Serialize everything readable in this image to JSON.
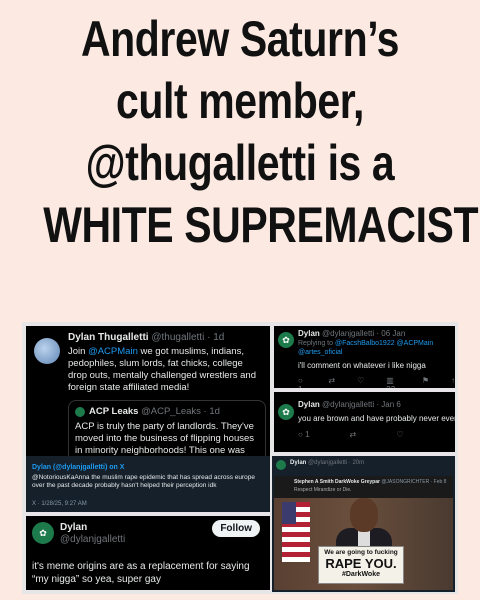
{
  "headline": {
    "line1": "Andrew Saturn’s",
    "line2": "cult member,",
    "line3": "@thugalletti is a",
    "line4": "WHITE SUPREMACIST"
  },
  "tweet1": {
    "name": "Dylan Thugalletti",
    "handle_time": "@thugalletti · 1d",
    "text_pre": "Join ",
    "mention": "@ACPMain",
    "text_post": " we got muslims, indians, pedophiles, slum lords, fat chicks, college drop outs, mentally challenged wrestlers and foreign state affiliated media!",
    "quote": {
      "name": "ACP Leaks",
      "handle_time": "@ACP_Leaks · 1d",
      "text": "ACP is truly the party of landlords. They've moved into the business of flipping houses in minority neighborhoods! This one was"
    }
  },
  "tweet2": {
    "name": "Dylan",
    "handle_time": "@dylanjgalletti · 06 Jan",
    "reply_prefix": "Replying to ",
    "reply_mentions": "@FacshBalbo1922 @ACPMain @artes_oficial",
    "text": "i'll comment on whatever i like nigga",
    "stats": [
      "1",
      "",
      "",
      "23",
      "",
      ""
    ]
  },
  "tweet3": {
    "name": "Dylan",
    "handle_time": "@dylanjgalletti · Jan 6",
    "text": "you are brown and have probably never even h",
    "stats": [
      "1",
      "",
      ""
    ]
  },
  "tweet4": {
    "header": "Dylan (@dylanjgalletti) on X",
    "text": "@NotoriousKaAnna the muslim rape epidemic that has spread across europe over the past decade probably hasn't helped their perception idk",
    "footer": "X · 1/28/25, 9:27 AM"
  },
  "tweet5": {
    "name": "Dylan",
    "handle": "@dylanjgalletti",
    "follow_label": "Follow",
    "text": "it's meme origins are as a replacement for saying “my nigga” so yea, super gay"
  },
  "tweet6": {
    "name": "Dylan",
    "handle_time": "@dylanjgalletti · 20m",
    "quoted_name": "Stephen A Smith DarkWoke Greypar",
    "quoted_meta": "@JASONGRICHTER · Feb 8",
    "quoted_text": "Respect Mirandize or Die.",
    "sign_line1": "We are going to fucking",
    "sign_line2": "RAPE YOU.",
    "sign_line3": "#DarkWoke"
  }
}
